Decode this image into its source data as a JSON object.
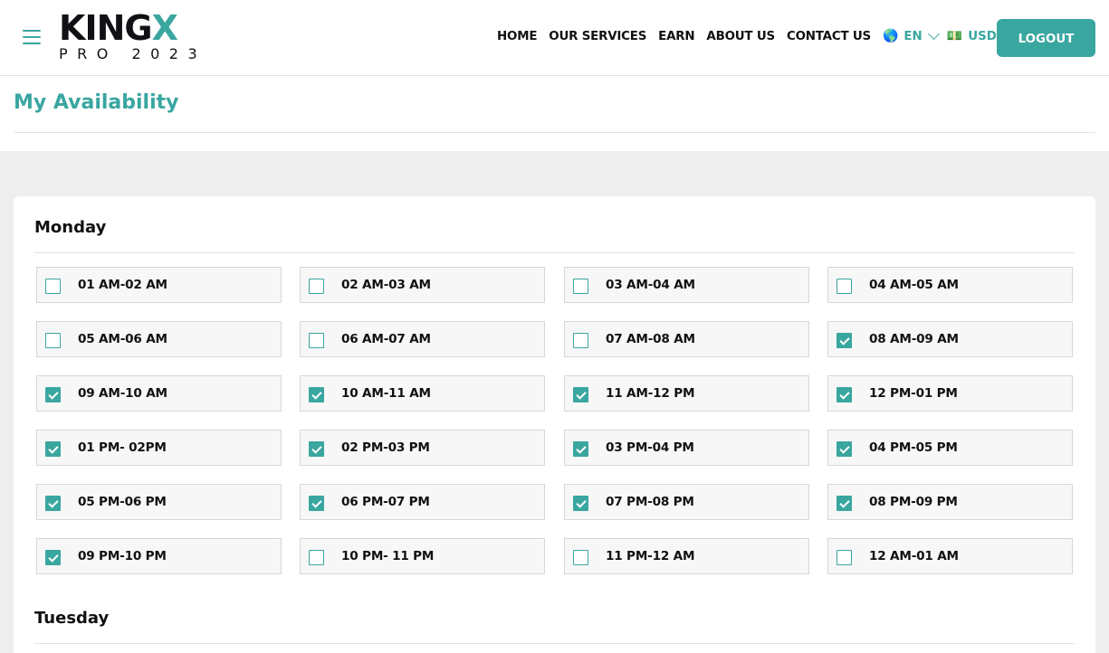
{
  "brand": {
    "logo_main_a": "KING",
    "logo_main_b": "X",
    "logo_sub": "PRO 2023"
  },
  "nav": {
    "items": [
      "HOME",
      "OUR SERVICES",
      "EARN",
      "ABOUT US",
      "CONTACT US"
    ],
    "language": {
      "label": "EN",
      "flag": "🌎"
    },
    "currency": {
      "label": "USD",
      "flag": "💵"
    },
    "logout_label": "LOGOUT"
  },
  "page": {
    "title": "My Availability"
  },
  "colors": {
    "accent": "#3aa6a0"
  },
  "days": [
    {
      "name": "Monday",
      "slots": [
        {
          "label": "01 AM-02 AM",
          "checked": false
        },
        {
          "label": "02 AM-03 AM",
          "checked": false
        },
        {
          "label": "03 AM-04 AM",
          "checked": false
        },
        {
          "label": "04 AM-05 AM",
          "checked": false
        },
        {
          "label": "05 AM-06 AM",
          "checked": false
        },
        {
          "label": "06 AM-07 AM",
          "checked": false
        },
        {
          "label": "07 AM-08 AM",
          "checked": false
        },
        {
          "label": "08 AM-09 AM",
          "checked": true
        },
        {
          "label": "09 AM-10 AM",
          "checked": true
        },
        {
          "label": "10 AM-11 AM",
          "checked": true
        },
        {
          "label": "11 AM-12 PM",
          "checked": true
        },
        {
          "label": "12 PM-01 PM",
          "checked": true
        },
        {
          "label": "01 PM- 02PM",
          "checked": true
        },
        {
          "label": "02 PM-03 PM",
          "checked": true
        },
        {
          "label": "03 PM-04 PM",
          "checked": true
        },
        {
          "label": "04 PM-05 PM",
          "checked": true
        },
        {
          "label": "05 PM-06 PM",
          "checked": true
        },
        {
          "label": "06 PM-07 PM",
          "checked": true
        },
        {
          "label": "07 PM-08 PM",
          "checked": true
        },
        {
          "label": "08 PM-09 PM",
          "checked": true
        },
        {
          "label": "09 PM-10 PM",
          "checked": true
        },
        {
          "label": "10 PM- 11 PM",
          "checked": false
        },
        {
          "label": "11 PM-12 AM",
          "checked": false
        },
        {
          "label": "12 AM-01 AM",
          "checked": false
        }
      ]
    },
    {
      "name": "Tuesday",
      "slots": []
    }
  ]
}
